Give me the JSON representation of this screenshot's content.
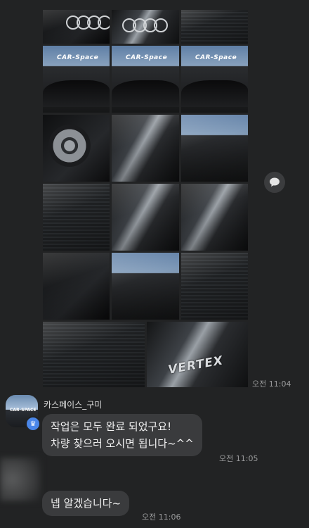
{
  "photos": {
    "rows": [
      [
        {
          "kind": "grille"
        },
        {
          "kind": "rings"
        },
        {
          "kind": "grille2"
        }
      ],
      [
        {
          "kind": "showroom",
          "sign": "CAR-Space"
        },
        {
          "kind": "showroom",
          "sign": "CAR-Space"
        },
        {
          "kind": "showroom",
          "sign": "CAR-Space"
        }
      ],
      [
        {
          "kind": "wheel"
        },
        {
          "kind": "chrome"
        },
        {
          "kind": "door"
        }
      ],
      [
        {
          "kind": "glass"
        },
        {
          "kind": "headlight"
        },
        {
          "kind": "headlight"
        }
      ],
      [
        {
          "kind": "roof"
        },
        {
          "kind": "roof"
        },
        {
          "kind": "glass"
        }
      ],
      [
        {
          "kind": "sunroof"
        },
        {
          "kind": "badge",
          "badge_text": "VERTEX"
        }
      ]
    ],
    "timestamp": "오전 11:04"
  },
  "share_icon": "chat-bubble-icon",
  "sender": {
    "name": "카스페이스_구미",
    "avatar_text": "CAR-SPACE",
    "badge_icon": "crown-icon"
  },
  "messages": [
    {
      "side": "left",
      "text_line1": "작업은 모두 완료 되었구요!",
      "text_line2": "차량 찾으러 오시면 됩니다~^^",
      "timestamp": "오전 11:05"
    },
    {
      "side": "left",
      "text": "넵 알겠습니다~",
      "timestamp": "오전 11:06"
    }
  ]
}
